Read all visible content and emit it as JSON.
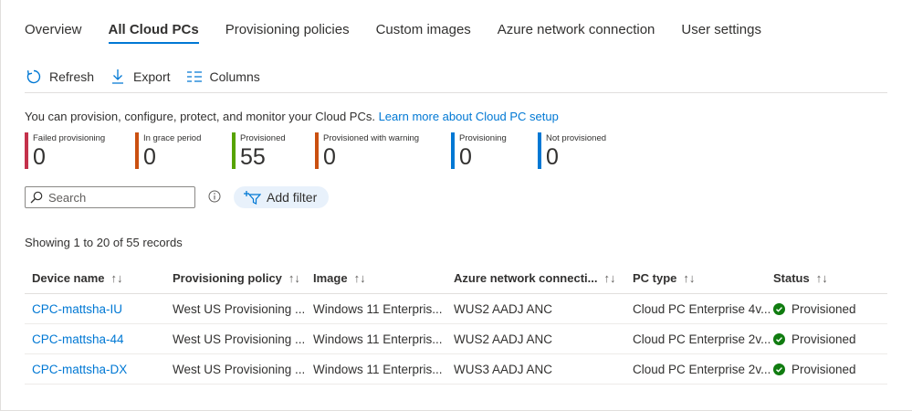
{
  "tabs": [
    {
      "label": "Overview"
    },
    {
      "label": "All Cloud PCs",
      "active": true
    },
    {
      "label": "Provisioning policies"
    },
    {
      "label": "Custom images"
    },
    {
      "label": "Azure network connection"
    },
    {
      "label": "User settings"
    }
  ],
  "toolbar": {
    "refresh_label": "Refresh",
    "export_label": "Export",
    "columns_label": "Columns"
  },
  "info": {
    "text": "You can provision, configure, protect, and monitor your Cloud PCs.",
    "link": "Learn more about Cloud PC setup"
  },
  "tiles": [
    {
      "label": "Failed provisioning",
      "value": "0",
      "color": "#c4314b"
    },
    {
      "label": "In grace period",
      "value": "0",
      "color": "#ca5010"
    },
    {
      "label": "Provisioned",
      "value": "55",
      "color": "#57a300"
    },
    {
      "label": "Provisioned with warning",
      "value": "0",
      "color": "#ca5010"
    },
    {
      "label": "Provisioning",
      "value": "0",
      "color": "#0078d4"
    },
    {
      "label": "Not provisioned",
      "value": "0",
      "color": "#0078d4"
    }
  ],
  "search": {
    "placeholder": "Search"
  },
  "add_filter_label": "Add filter",
  "records_text": "Showing 1 to 20 of 55 records",
  "table": {
    "columns": [
      "Device name",
      "Provisioning policy",
      "Image",
      "Azure network connecti...",
      "PC type",
      "Status"
    ],
    "sort_glyph": "↑↓",
    "rows": [
      [
        "CPC-mattsha-IU",
        "West US Provisioning ...",
        "Windows 11 Enterpris...",
        "WUS2 AADJ ANC",
        "Cloud PC Enterprise 4v...",
        "Provisioned"
      ],
      [
        "CPC-mattsha-44",
        "West US Provisioning ...",
        "Windows 11 Enterpris...",
        "WUS2 AADJ ANC",
        "Cloud PC Enterprise 2v...",
        "Provisioned"
      ],
      [
        "CPC-mattsha-DX",
        "West US Provisioning ...",
        "Windows 11 Enterpris...",
        "WUS3 AADJ ANC",
        "Cloud PC Enterprise 2v...",
        "Provisioned"
      ]
    ]
  },
  "colors": {
    "accent": "#0078d4",
    "success": "#107c10"
  }
}
